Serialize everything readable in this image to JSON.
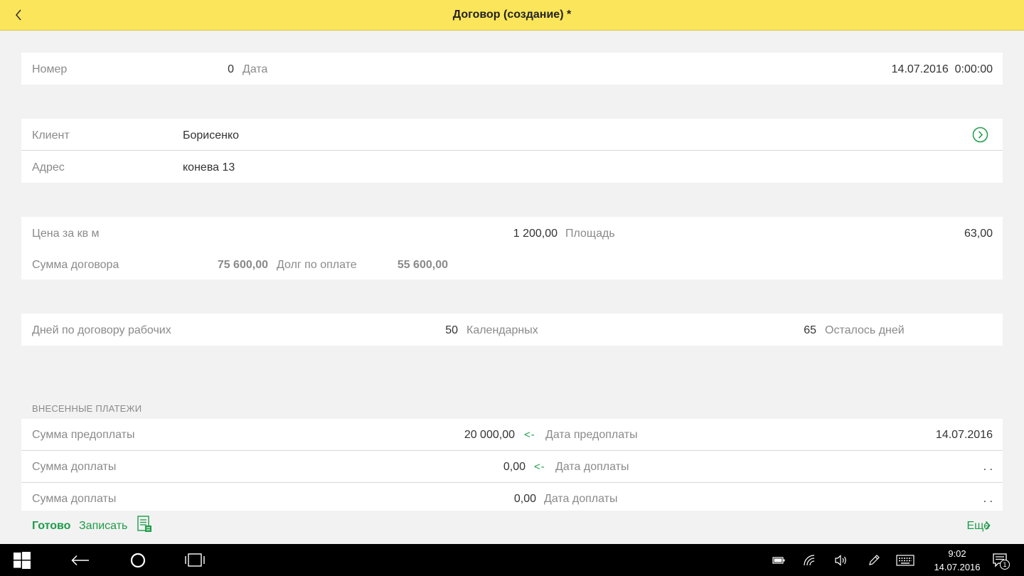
{
  "header": {
    "title": "Договор (создание) *"
  },
  "doc": {
    "number_label": "Номер",
    "number_value": "0",
    "date_label": "Дата",
    "date_value": "14.07.2016  0:00:00"
  },
  "client": {
    "client_label": "Клиент",
    "client_value": "Борисенко",
    "address_label": "Адрес",
    "address_value": "конева 13"
  },
  "price": {
    "price_label": "Цена за кв м",
    "price_value": "1 200,00",
    "area_label": "Площадь",
    "area_value": "63,00",
    "sum_label": "Сумма договора",
    "sum_value": "75 600,00",
    "debt_label": "Долг по оплате",
    "debt_value": "55 600,00"
  },
  "days": {
    "work_label": "Дней по договору рабочих",
    "work_value": "50",
    "calendar_label": "Календарных",
    "calendar_value": "65",
    "left_label": "Осталось дней"
  },
  "payments": {
    "section_title": "ВНЕСЕННЫЕ ПЛАТЕЖИ",
    "prepay_label": "Сумма предоплаты",
    "prepay_value": "20 000,00",
    "prepay_arrow": "<-",
    "prepay_date_label": "Дата предоплаты",
    "prepay_date_value": "14.07.2016",
    "extra1_label": "Сумма доплаты",
    "extra1_value": "0,00",
    "extra1_arrow": "<-",
    "extra1_date_label": "Дата доплаты",
    "extra1_date_value": ". .",
    "extra2_label": "Сумма доплаты",
    "extra2_value": "0,00",
    "extra2_date_label": "Дата доплаты",
    "extra2_date_value": ". ."
  },
  "bottombar": {
    "done_label": "Готово",
    "save_label": "Записать",
    "more_label": "Еще"
  },
  "taskbar": {
    "time": "9:02",
    "date": "14.07.2016",
    "notification_count": "1"
  },
  "colors": {
    "header_bg": "#fbe55a",
    "accent_green": "#1e9c48"
  }
}
